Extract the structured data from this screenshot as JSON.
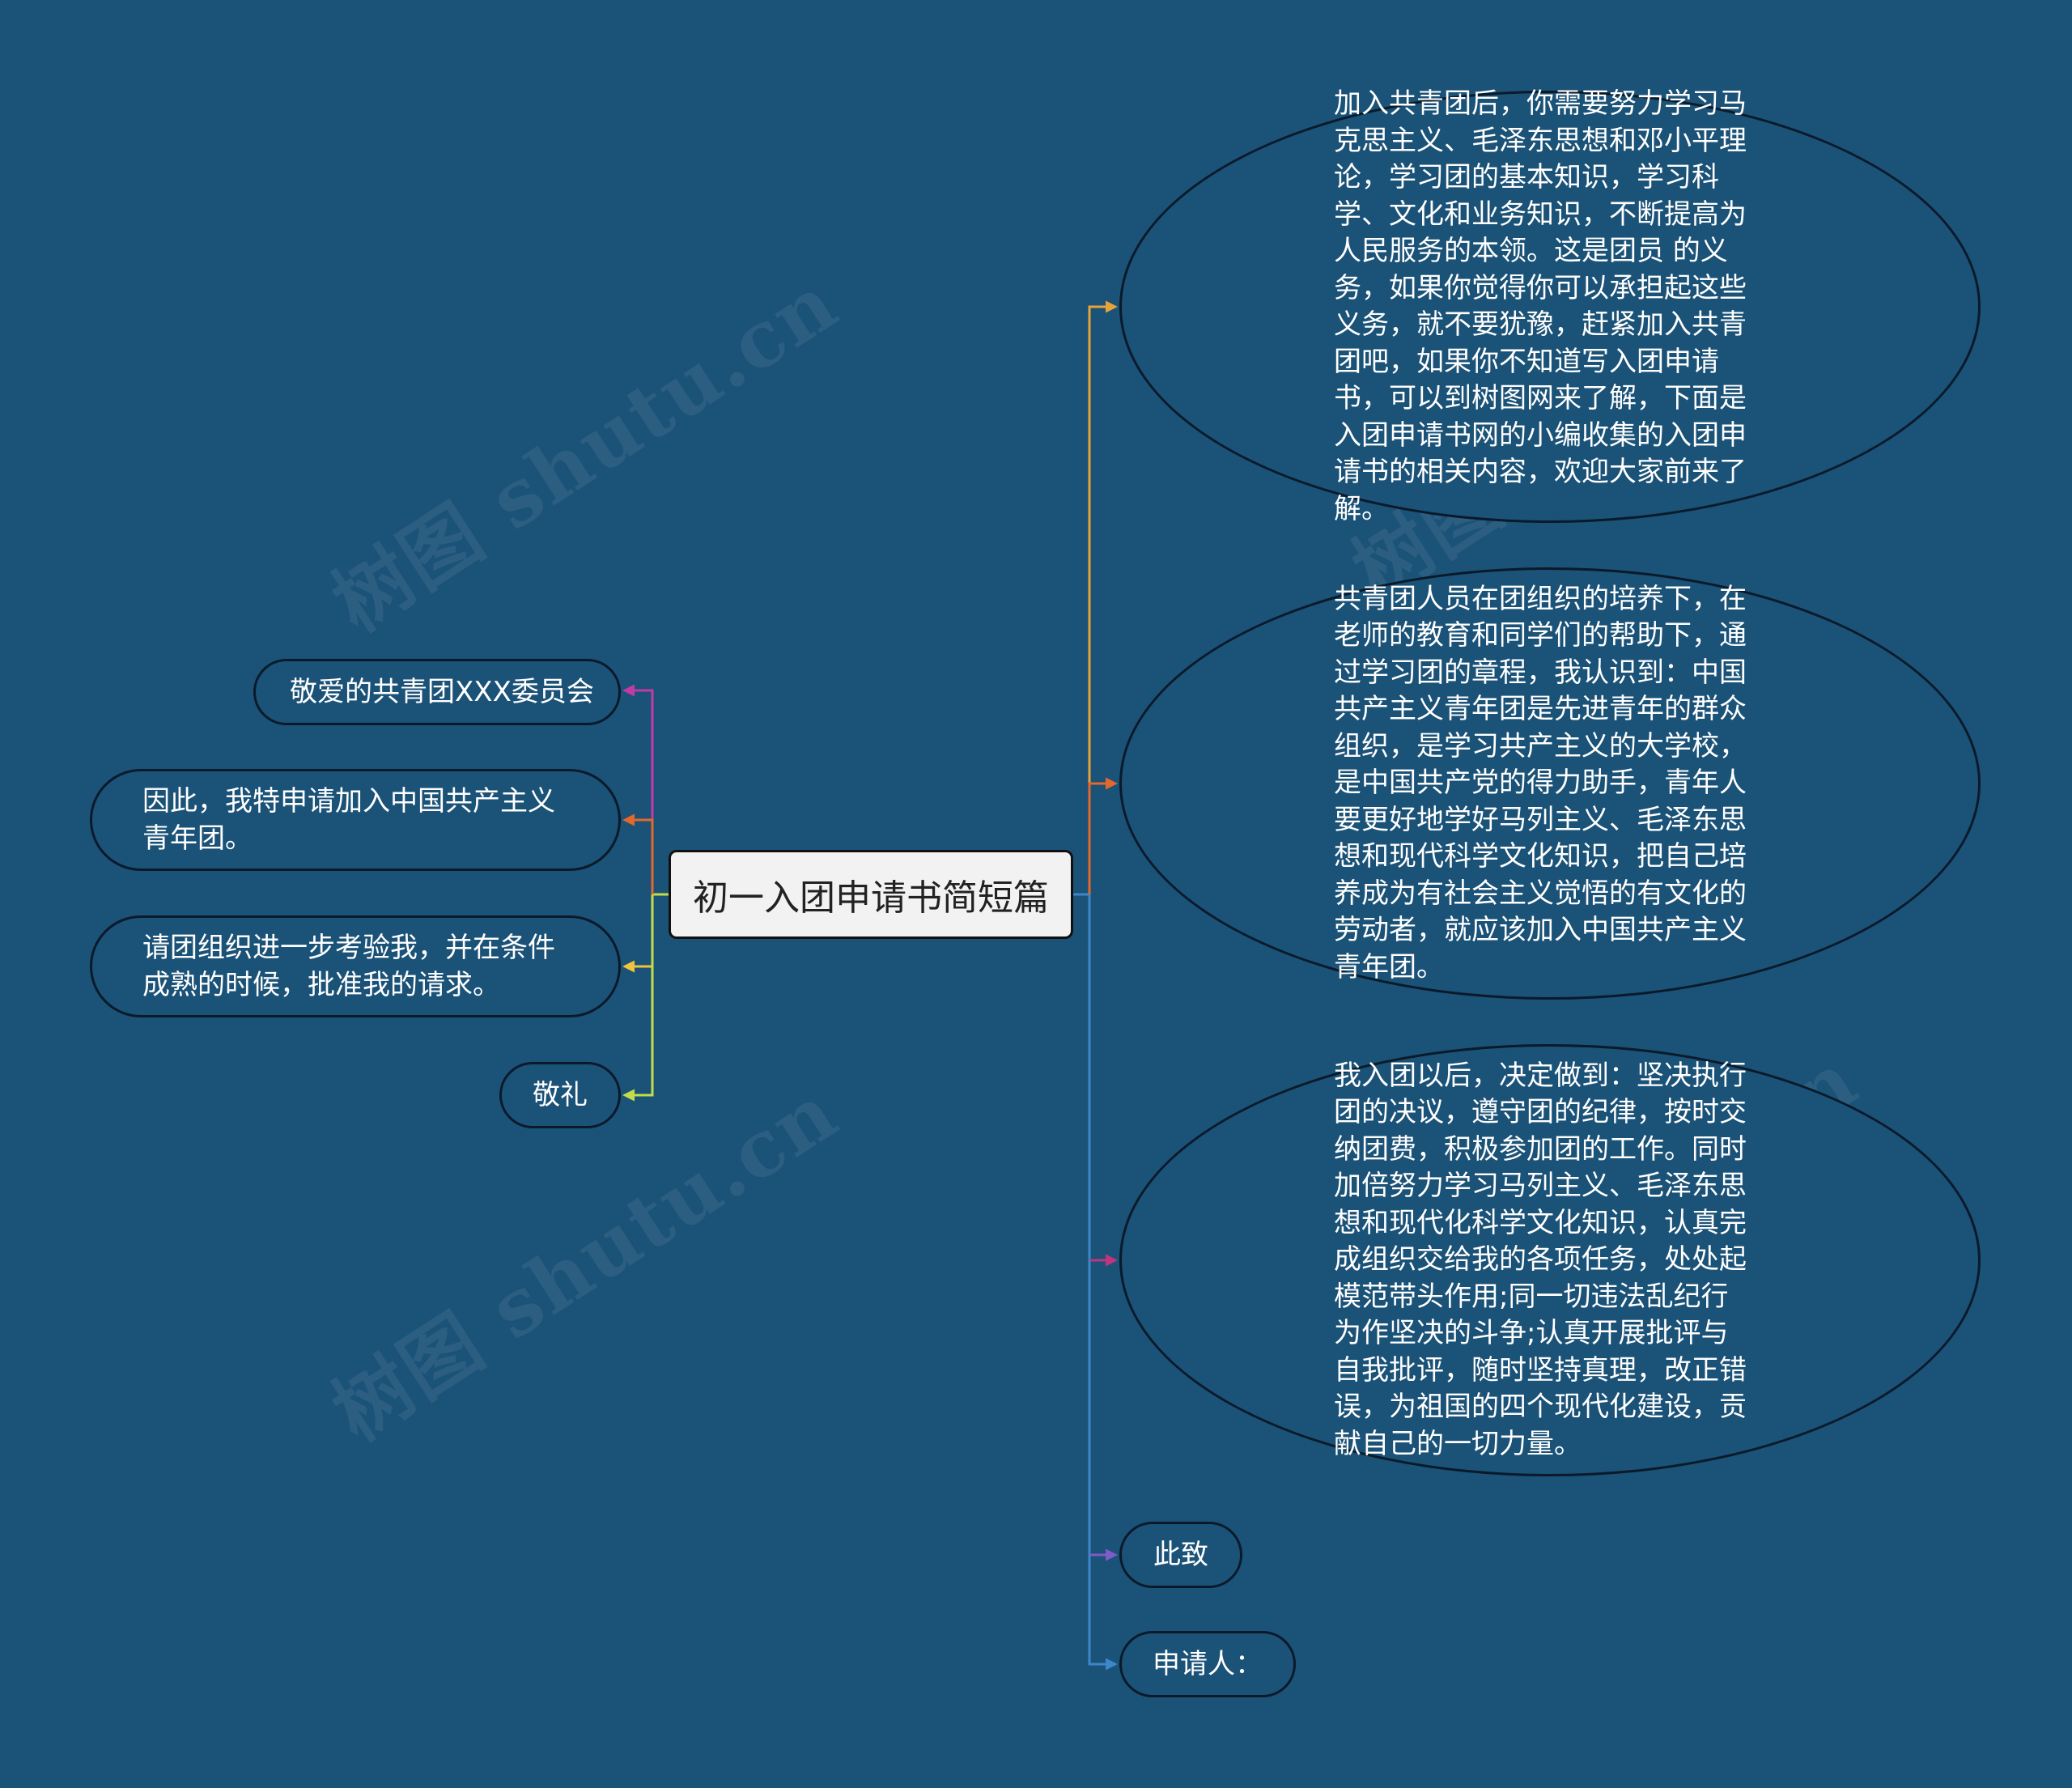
{
  "title": "初一入团申请书简短篇",
  "watermark_text": "树图 shutu.cn",
  "connector_colors": {
    "orange": "#e8a23a",
    "red_orange": "#e2682c",
    "magenta": "#c23aa8",
    "yellow": "#f0c33c",
    "lime": "#c3dd4a",
    "blue": "#3b87c9",
    "purple": "#7e5bc9",
    "pink": "#c2357e"
  },
  "left_nodes": [
    {
      "text": "敬爱的共青团XXX委员会"
    },
    {
      "text": "因此，我特申请加入中国共产主义青年团。"
    },
    {
      "text": "请团组织进一步考验我，并在条件成熟的时候，批准我的请求。"
    },
    {
      "text": "敬礼"
    }
  ],
  "right_nodes": [
    {
      "text": "加入共青团后，你需要努力学习马克思主义、毛泽东思想和邓小平理论，学习团的基本知识，学习科学、文化和业务知识，不断提高为人民服务的本领。这是团员 的义务，如果你觉得你可以承担起这些义务，就不要犹豫，赶紧加入共青团吧，如果你不知道写入团申请书，可以到树图网来了解，下面是入团申请书网的小编收集的入团申请书的相关内容，欢迎大家前来了解。"
    },
    {
      "text": "共青团人员在团组织的培养下，在老师的教育和同学们的帮助下，通过学习团的章程，我认识到：中国共产主义青年团是先进青年的群众组织，是学习共产主义的大学校，是中国共产党的得力助手，青年人要更好地学好马列主义、毛泽东思想和现代科学文化知识，把自己培养成为有社会主义觉悟的有文化的劳动者，就应该加入中国共产主义青年团。"
    },
    {
      "text": "我入团以后，决定做到：坚决执行团的决议，遵守团的纪律，按时交纳团费，积极参加团的工作。同时加倍努力学习马列主义、毛泽东思想和现代化科学文化知识，认真完成组织交给我的各项任务，处处起模范带头作用;同一切违法乱纪行为作坚决的斗争;认真开展批评与自我批评，随时坚持真理，改正错误，为祖国的四个现代化建设，贡献自己的一切力量。"
    },
    {
      "text": "此致"
    },
    {
      "text": "申请人："
    }
  ]
}
